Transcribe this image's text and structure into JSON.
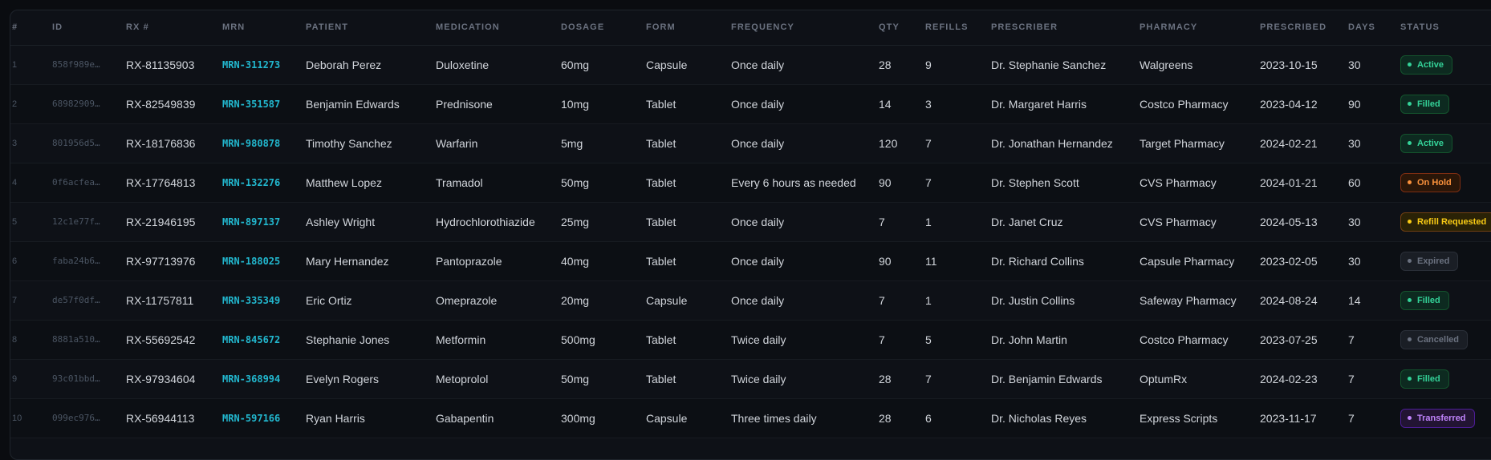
{
  "table": {
    "headers": [
      "#",
      "ID",
      "RX #",
      "MRN",
      "PATIENT",
      "MEDICATION",
      "DOSAGE",
      "FORM",
      "FREQUENCY",
      "QTY",
      "REFILLS",
      "PRESCRIBER",
      "PHARMACY",
      "PRESCRIBED",
      "DAYS",
      "STATUS"
    ],
    "rows": [
      {
        "n": "1",
        "id": "858f989e…",
        "rx": "RX-81135903",
        "mrn": "MRN-311273",
        "patient": "Deborah Perez",
        "medication": "Duloxetine",
        "dosage": "60mg",
        "form": "Capsule",
        "frequency": "Once daily",
        "qty": "28",
        "refills": "9",
        "prescriber": "Dr. Stephanie Sanchez",
        "pharmacy": "Walgreens",
        "prescribed": "2023-10-15",
        "days": "30",
        "status": "Active"
      },
      {
        "n": "2",
        "id": "68982909…",
        "rx": "RX-82549839",
        "mrn": "MRN-351587",
        "patient": "Benjamin Edwards",
        "medication": "Prednisone",
        "dosage": "10mg",
        "form": "Tablet",
        "frequency": "Once daily",
        "qty": "14",
        "refills": "3",
        "prescriber": "Dr. Margaret Harris",
        "pharmacy": "Costco Pharmacy",
        "prescribed": "2023-04-12",
        "days": "90",
        "status": "Filled"
      },
      {
        "n": "3",
        "id": "801956d5…",
        "rx": "RX-18176836",
        "mrn": "MRN-980878",
        "patient": "Timothy Sanchez",
        "medication": "Warfarin",
        "dosage": "5mg",
        "form": "Tablet",
        "frequency": "Once daily",
        "qty": "120",
        "refills": "7",
        "prescriber": "Dr. Jonathan Hernandez",
        "pharmacy": "Target Pharmacy",
        "prescribed": "2024-02-21",
        "days": "30",
        "status": "Active"
      },
      {
        "n": "4",
        "id": "0f6acfea…",
        "rx": "RX-17764813",
        "mrn": "MRN-132276",
        "patient": "Matthew Lopez",
        "medication": "Tramadol",
        "dosage": "50mg",
        "form": "Tablet",
        "frequency": "Every 6 hours as needed",
        "qty": "90",
        "refills": "7",
        "prescriber": "Dr. Stephen Scott",
        "pharmacy": "CVS Pharmacy",
        "prescribed": "2024-01-21",
        "days": "60",
        "status": "On Hold"
      },
      {
        "n": "5",
        "id": "12c1e77f…",
        "rx": "RX-21946195",
        "mrn": "MRN-897137",
        "patient": "Ashley Wright",
        "medication": "Hydrochlorothiazide",
        "dosage": "25mg",
        "form": "Tablet",
        "frequency": "Once daily",
        "qty": "7",
        "refills": "1",
        "prescriber": "Dr. Janet Cruz",
        "pharmacy": "CVS Pharmacy",
        "prescribed": "2024-05-13",
        "days": "30",
        "status": "Refill Requested"
      },
      {
        "n": "6",
        "id": "faba24b6…",
        "rx": "RX-97713976",
        "mrn": "MRN-188025",
        "patient": "Mary Hernandez",
        "medication": "Pantoprazole",
        "dosage": "40mg",
        "form": "Tablet",
        "frequency": "Once daily",
        "qty": "90",
        "refills": "11",
        "prescriber": "Dr. Richard Collins",
        "pharmacy": "Capsule Pharmacy",
        "prescribed": "2023-02-05",
        "days": "30",
        "status": "Expired"
      },
      {
        "n": "7",
        "id": "de57f0df…",
        "rx": "RX-11757811",
        "mrn": "MRN-335349",
        "patient": "Eric Ortiz",
        "medication": "Omeprazole",
        "dosage": "20mg",
        "form": "Capsule",
        "frequency": "Once daily",
        "qty": "7",
        "refills": "1",
        "prescriber": "Dr. Justin Collins",
        "pharmacy": "Safeway Pharmacy",
        "prescribed": "2024-08-24",
        "days": "14",
        "status": "Filled"
      },
      {
        "n": "8",
        "id": "8881a510…",
        "rx": "RX-55692542",
        "mrn": "MRN-845672",
        "patient": "Stephanie Jones",
        "medication": "Metformin",
        "dosage": "500mg",
        "form": "Tablet",
        "frequency": "Twice daily",
        "qty": "7",
        "refills": "5",
        "prescriber": "Dr. John Martin",
        "pharmacy": "Costco Pharmacy",
        "prescribed": "2023-07-25",
        "days": "7",
        "status": "Cancelled"
      },
      {
        "n": "9",
        "id": "93c01bbd…",
        "rx": "RX-97934604",
        "mrn": "MRN-368994",
        "patient": "Evelyn Rogers",
        "medication": "Metoprolol",
        "dosage": "50mg",
        "form": "Tablet",
        "frequency": "Twice daily",
        "qty": "28",
        "refills": "7",
        "prescriber": "Dr. Benjamin Edwards",
        "pharmacy": "OptumRx",
        "prescribed": "2024-02-23",
        "days": "7",
        "status": "Filled"
      },
      {
        "n": "10",
        "id": "099ec976…",
        "rx": "RX-56944113",
        "mrn": "MRN-597166",
        "patient": "Ryan Harris",
        "medication": "Gabapentin",
        "dosage": "300mg",
        "form": "Capsule",
        "frequency": "Three times daily",
        "qty": "28",
        "refills": "6",
        "prescriber": "Dr. Nicholas Reyes",
        "pharmacy": "Express Scripts",
        "prescribed": "2023-11-17",
        "days": "7",
        "status": "Transferred"
      }
    ]
  },
  "status_colors": {
    "Active": {
      "fg": "#34d399",
      "bg": "#0d2a20",
      "border": "#14532d"
    },
    "Filled": {
      "fg": "#34d399",
      "bg": "#0d2a20",
      "border": "#14532d"
    },
    "On Hold": {
      "fg": "#fb923c",
      "bg": "#2a1608",
      "border": "#7c2d12"
    },
    "Refill Requested": {
      "fg": "#facc15",
      "bg": "#2a2206",
      "border": "#713f12"
    },
    "Expired": {
      "fg": "#6b7280",
      "bg": "#1a1e25",
      "border": "#2a2f38"
    },
    "Cancelled": {
      "fg": "#6b7280",
      "bg": "#1a1e25",
      "border": "#2a2f38"
    },
    "Transferred": {
      "fg": "#c084fc",
      "bg": "#221433",
      "border": "#4c1d95"
    }
  }
}
